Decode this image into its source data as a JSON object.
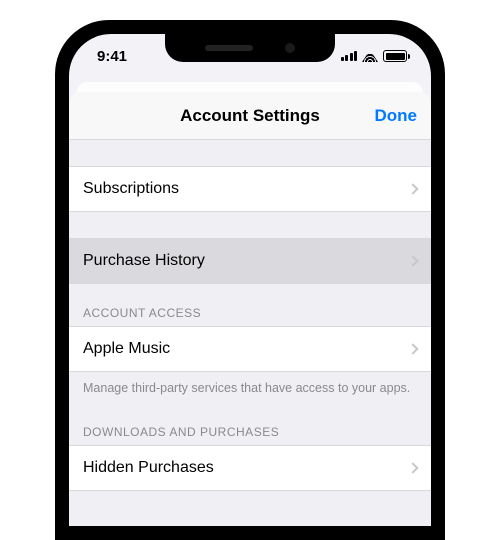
{
  "status": {
    "time": "9:41"
  },
  "nav": {
    "title": "Account Settings",
    "done": "Done"
  },
  "rows": {
    "subscriptions": "Subscriptions",
    "purchase_history": "Purchase History",
    "apple_music": "Apple Music",
    "hidden_purchases": "Hidden Purchases"
  },
  "sections": {
    "account_access_header": "ACCOUNT ACCESS",
    "account_access_footer": "Manage third-party services that have access to your apps.",
    "downloads_header": "DOWNLOADS AND PURCHASES"
  }
}
